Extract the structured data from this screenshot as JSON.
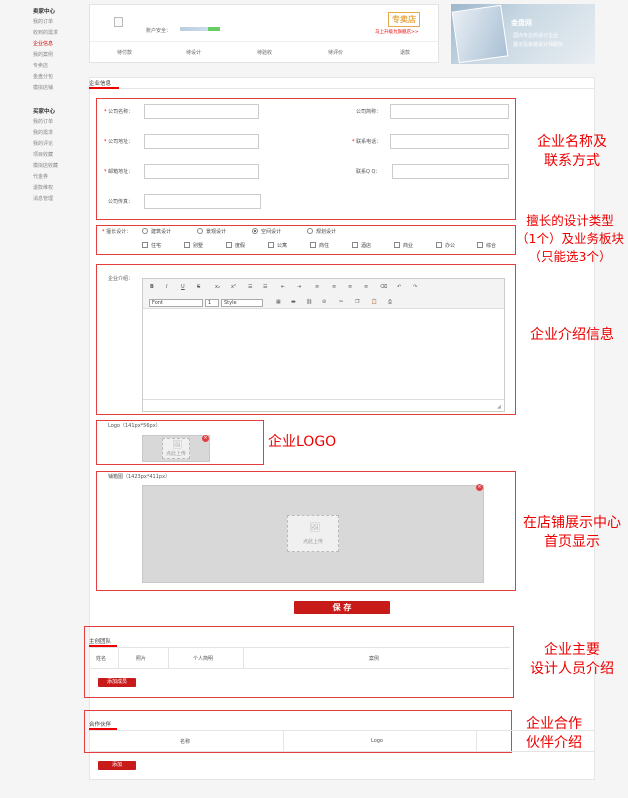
{
  "sidebar": {
    "seller_title": "卖家中心",
    "seller_items": [
      "我的订单",
      "收到的需求",
      "企业信息",
      "我的案例",
      "专卖店",
      "金盘分包",
      "模拟店铺"
    ],
    "buyer_title": "买家中心",
    "buyer_items": [
      "我的订单",
      "我的需求",
      "我的评论",
      "项目收藏",
      "模拟店收藏",
      "代金券",
      "退款维权",
      "消息管理"
    ]
  },
  "top": {
    "account_security": "账户安全：",
    "shop_badge": "专卖店",
    "upgrade_link": "马上升级为旗舰店>>",
    "nav": [
      "待付款",
      "待设计",
      "待验收",
      "待评价",
      "退款"
    ]
  },
  "banner": {
    "brand": "金盘网",
    "line1": "国内专业的设计企业",
    "line2": "展示及家装设计师服务"
  },
  "form": {
    "section_title": "企业信息",
    "company_name": "公司名称：",
    "company_abbr": "公司简称：",
    "company_addr": "公司地址：",
    "contact_phone": "联系电话：",
    "email": "邮箱地址：",
    "qq": "联系Q Q：",
    "fax": "公司传真："
  },
  "design": {
    "label": "擅长设计：",
    "radios": [
      "建筑设计",
      "景观设计",
      "空间设计",
      "规划设计"
    ],
    "checkboxes": [
      "住宅",
      "别墅",
      "度假",
      "公寓",
      "商住",
      "酒店",
      "商业",
      "办公",
      "综合"
    ]
  },
  "intro": {
    "label": "企业介绍：",
    "font_select": "Font",
    "size_select": "1",
    "style_select": "Style"
  },
  "logo": {
    "label": "Logo（141px*56px）",
    "upload_text": "点此上传"
  },
  "shop_image": {
    "label": "铺箱图（1423px*411px）",
    "upload_text": "点此上传"
  },
  "save_button": "保 存",
  "team": {
    "title": "主创团队",
    "columns": [
      "姓名",
      "照片",
      "个人简明",
      "案例"
    ],
    "add_button": "添加成员"
  },
  "partners": {
    "title": "合作伙伴",
    "columns": [
      "名称",
      "Logo"
    ],
    "add_button": "添加"
  },
  "annotations": {
    "name_contact": [
      "企业名称及",
      "联系方式"
    ],
    "design_type": [
      "擅长的设计类型",
      "（1个）及业务板块",
      "（只能选3个）"
    ],
    "intro": "企业介绍信息",
    "logo": "企业LOGO",
    "shop_display": [
      "在店铺展示中心",
      "首页显示"
    ],
    "team": [
      "企业主要",
      "设计人员介绍"
    ],
    "partners": [
      "企业合作",
      "伙伴介绍"
    ]
  }
}
